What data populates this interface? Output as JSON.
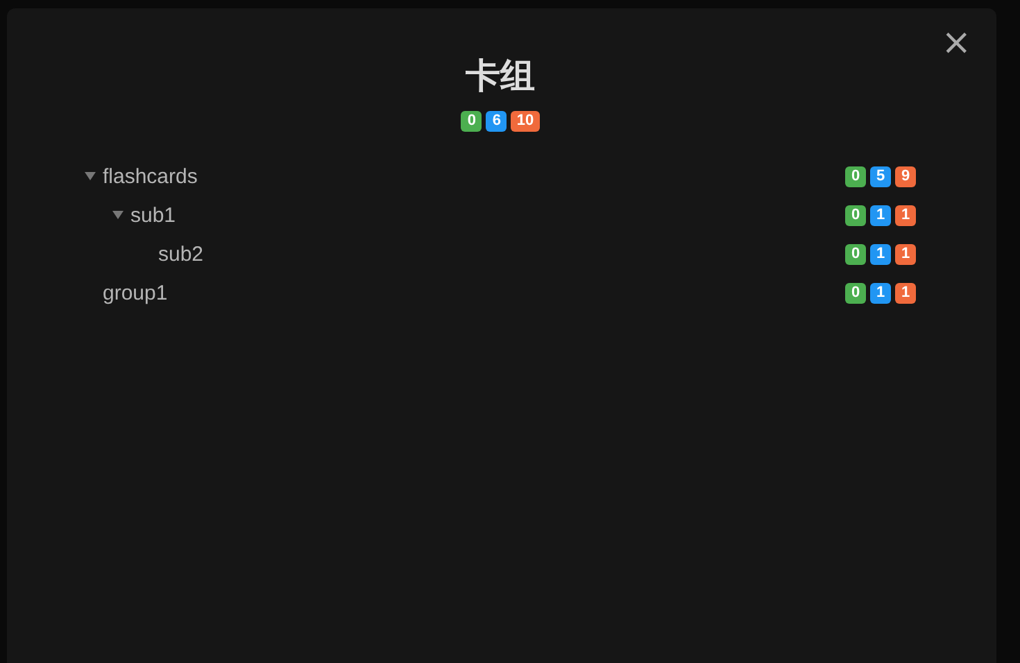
{
  "modal": {
    "title": "卡组",
    "close": "×",
    "counts": [
      {
        "text": "0",
        "color": "#4caf50"
      },
      {
        "text": "6",
        "color": "#2196f3"
      },
      {
        "text": "10",
        "color": "#f06a3c"
      }
    ]
  },
  "decks": [
    {
      "name": "flashcards",
      "expanded": true,
      "counts": [
        {
          "text": "0",
          "color": "#4caf50"
        },
        {
          "text": "5",
          "color": "#2196f3"
        },
        {
          "text": "9",
          "color": "#f06a3c"
        }
      ],
      "children": [
        {
          "name": "sub1",
          "expanded": true,
          "counts": [
            {
              "text": "0",
              "color": "#4caf50"
            },
            {
              "text": "1",
              "color": "#2196f3"
            },
            {
              "text": "1",
              "color": "#f06a3c"
            }
          ],
          "children": [
            {
              "name": "sub2",
              "counts": [
                {
                  "text": "0",
                  "color": "#4caf50"
                },
                {
                  "text": "1",
                  "color": "#2196f3"
                },
                {
                  "text": "1",
                  "color": "#f06a3c"
                }
              ]
            }
          ]
        }
      ]
    },
    {
      "name": "group1",
      "counts": [
        {
          "text": "0",
          "color": "#4caf50"
        },
        {
          "text": "1",
          "color": "#2196f3"
        },
        {
          "text": "1",
          "color": "#f06a3c"
        }
      ]
    }
  ]
}
